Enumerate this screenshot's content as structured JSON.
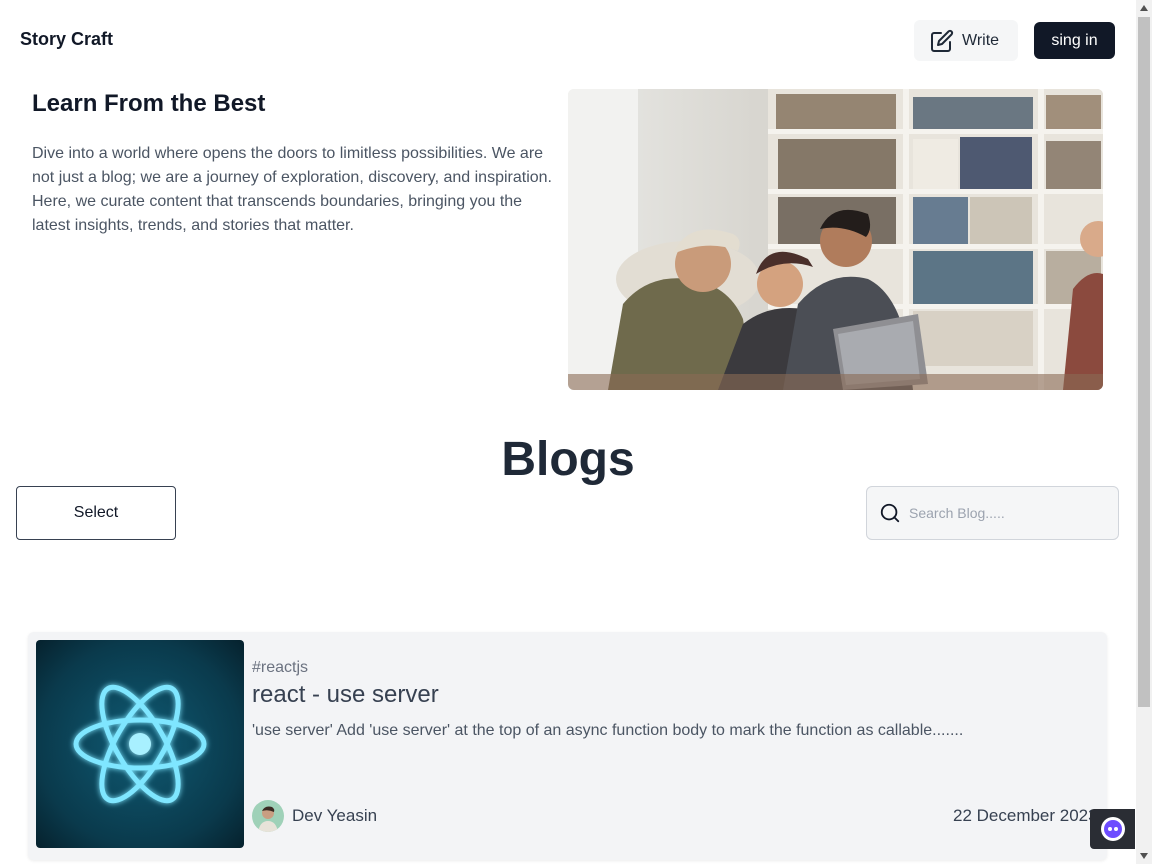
{
  "header": {
    "brand": "Story Craft",
    "write_label": "Write",
    "signin_label": "sing in"
  },
  "hero": {
    "title": "Learn From the Best",
    "text": "Dive into a world where opens the doors to limitless possibilities. We are not just a blog; we are a journey of exploration, discovery, and inspiration. Here, we curate content that transcends boundaries, bringing you the latest insights, trends, and stories that matter."
  },
  "blogs": {
    "title": "Blogs",
    "select_label": "Select",
    "search_placeholder": "Search Blog.....",
    "search_value": ""
  },
  "posts": [
    {
      "tag": "#reactjs",
      "title": "react - use server",
      "excerpt": "'use server' Add 'use server' at the top of an async function body to mark the function as callable.......",
      "author": "Dev Yeasin",
      "date": "22 December 2023"
    }
  ],
  "icons": {
    "write": "edit-icon",
    "search": "search-icon",
    "chat": "chat-bot-icon"
  },
  "colors": {
    "primary_dark": "#111827",
    "card_bg": "#f3f4f6",
    "react_cyan": "#61dafb"
  }
}
